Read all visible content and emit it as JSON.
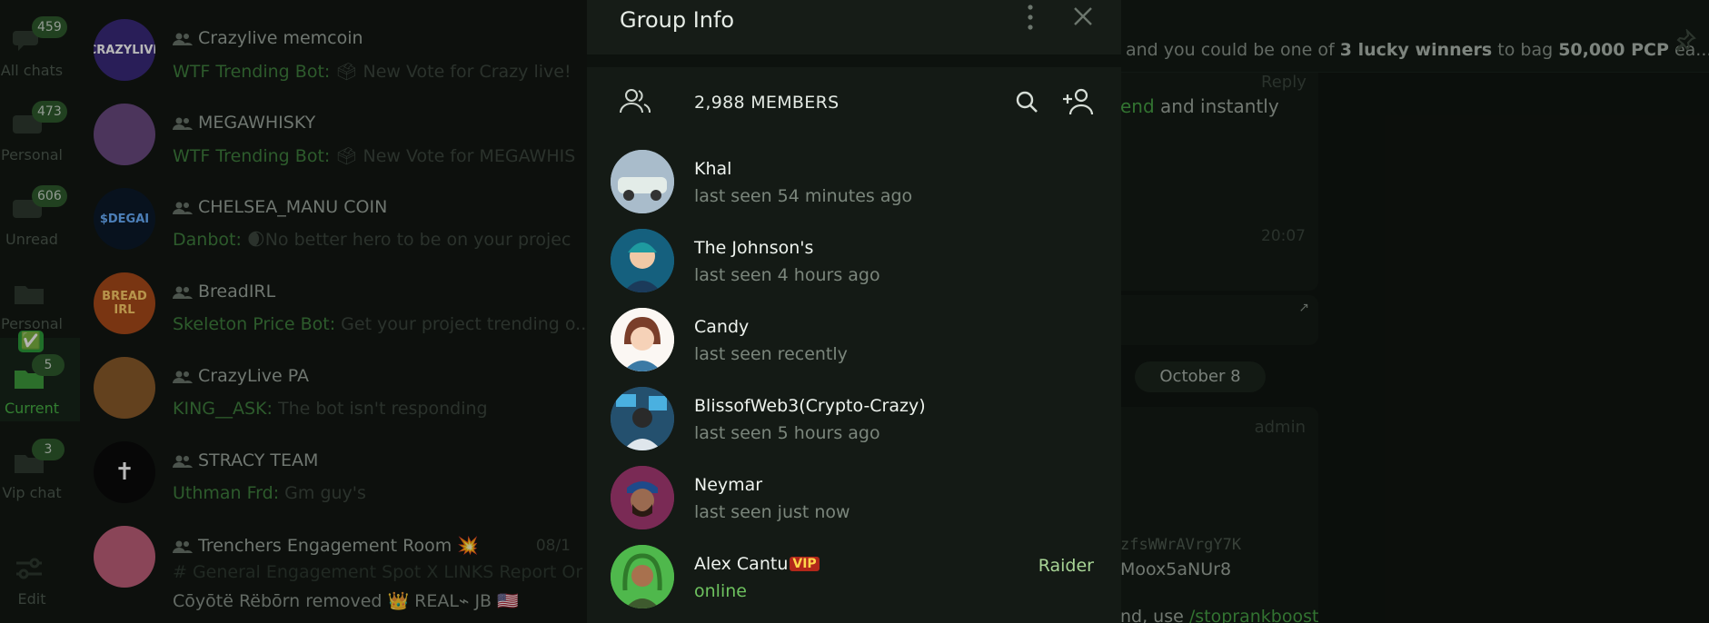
{
  "folders": [
    {
      "label": "All chats",
      "badge": "459"
    },
    {
      "label": "Personal",
      "badge": "473"
    },
    {
      "label": "Unread",
      "badge": "606"
    },
    {
      "label": "Personal",
      "badge": ""
    },
    {
      "label": "Current",
      "badge": "5",
      "emoji": "✅"
    },
    {
      "label": "Vip chat",
      "badge": "3"
    },
    {
      "label": "Edit",
      "badge": ""
    }
  ],
  "chats": [
    {
      "title": "Crazylive memcoin",
      "sender": "WTF Trending Bot:",
      "preview": "🗳 New Vote for Crazy live!",
      "avatar_text": "CRAZYLIVE",
      "avatar_color": "#3a2a7a"
    },
    {
      "title": "MEGAWHISKY",
      "sender": "WTF Trending Bot:",
      "preview": "🗳 New Vote for MEGAWHIS",
      "avatar_text": "",
      "avatar_color": "#6a4a80"
    },
    {
      "title": "CHELSEA_MANU COIN",
      "sender": "Danbot:",
      "preview": "🌒No better hero to be on your projec",
      "avatar_text": "$DEGAI",
      "avatar_color": "#0c1a2a"
    },
    {
      "title": "BreadIRL",
      "sender": "Skeleton Price Bot:",
      "preview": "Get your project trending o...",
      "avatar_text": "BREAD IRL",
      "avatar_color": "#a84a1a"
    },
    {
      "title": "CrazyLive PA",
      "sender": "KING__ASK:",
      "preview": "The bot isn't responding",
      "avatar_text": "",
      "avatar_color": "#8a5a2a"
    },
    {
      "title": "STRACY TEAM",
      "sender": "Uthman Frd:",
      "preview": "Gm guy's",
      "avatar_text": "✝",
      "avatar_color": "#0a0a0a"
    },
    {
      "title": "Trenchers Engagement Room 💥",
      "sender": "Cōyōtë Rëbōrn",
      "preview": "removed 👑 REAL⌁ JB 🇺🇸",
      "date": "08/1",
      "tags": "# General  Engagement Spot  X LINKS  Report Or C",
      "avatar_text": "",
      "avatar_color": "#c0607a"
    }
  ],
  "chat_area": {
    "pinned_pre": "and you could be one of ",
    "pinned_bold1": "3 lucky winners",
    "pinned_mid": " to bag ",
    "pinned_bold2": "50,000 PCP",
    "pinned_post": " ea...",
    "reply_label": "Reply",
    "msg_link": "end",
    "msg_text": " and instantly",
    "msg_time": "20:07",
    "date_pill": "October 8",
    "admin_label": "admin",
    "code1": "zfsWWrAVrgY7K",
    "code2": "Moox5aNUr8",
    "code3_pre": "nd, use ",
    "code3_link": "/stoprankboost"
  },
  "modal": {
    "title": "Group Info",
    "members_count": "2,988 MEMBERS",
    "members": [
      {
        "name": "Khal",
        "status": "last seen 54 minutes ago",
        "role": "",
        "online": false,
        "color": "#8fa5b5"
      },
      {
        "name": "The Johnson's",
        "status": "last seen 4 hours ago",
        "role": "",
        "online": false,
        "color": "#1b6a8a"
      },
      {
        "name": "Candy",
        "status": "last seen recently",
        "role": "",
        "online": false,
        "color": "#f2e6dc"
      },
      {
        "name": "BlissofWeb3(Crypto-Crazy)",
        "status": "last seen 5 hours ago",
        "role": "",
        "online": false,
        "color": "#2b5a7a"
      },
      {
        "name": "Neymar",
        "status": "last seen just now",
        "role": "",
        "online": false,
        "color": "#6a2a4a"
      },
      {
        "name": "Alex Cantu",
        "vip": "VIP",
        "status": "online",
        "role": "Raider",
        "online": true,
        "color": "#3aa040"
      }
    ]
  },
  "colors": {
    "accent": "#47b045",
    "modal_bg": "#141a15",
    "online": "#6ec25f"
  }
}
